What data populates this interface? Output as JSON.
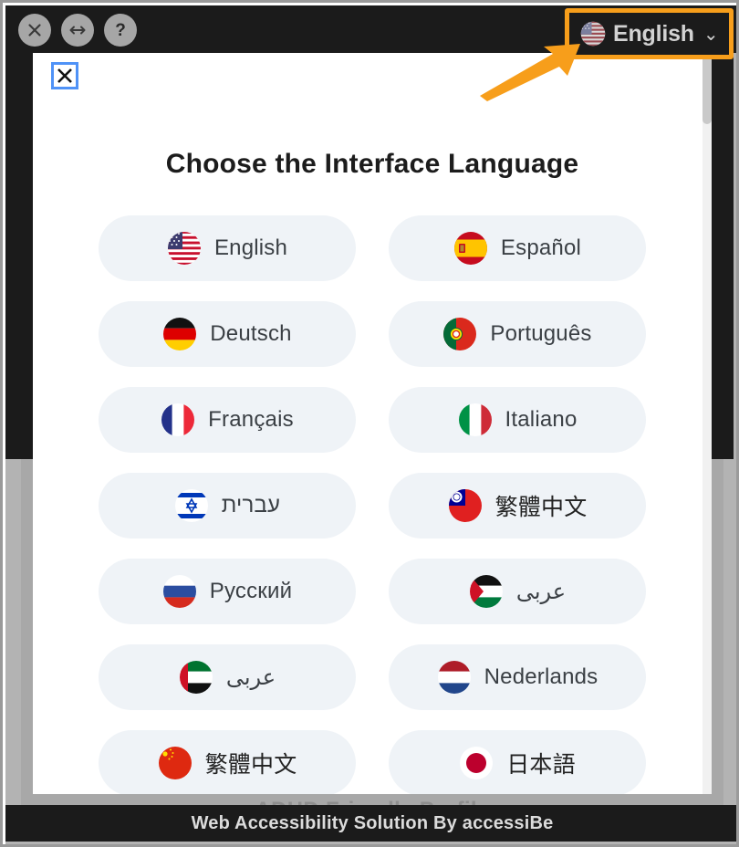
{
  "window": {
    "toolbar": {
      "close_label": "✕",
      "resize_label": "↔",
      "help_label": "?"
    },
    "language_selector": {
      "label": "English",
      "chevron": "⌄",
      "flag": "flag-us-icon",
      "highlight_color": "#F79E1B"
    },
    "footer_text": "Web Accessibility Solution By accessiBe"
  },
  "dialog": {
    "close_label": "✕",
    "title": "Choose the Interface Language",
    "languages": [
      {
        "label": "English",
        "flag": "flag-us-icon",
        "rtl": false,
        "cjk": false
      },
      {
        "label": "Español",
        "flag": "flag-es-icon",
        "rtl": false,
        "cjk": false
      },
      {
        "label": "Deutsch",
        "flag": "flag-de-icon",
        "rtl": false,
        "cjk": false
      },
      {
        "label": "Português",
        "flag": "flag-pt-icon",
        "rtl": false,
        "cjk": false
      },
      {
        "label": "Français",
        "flag": "flag-fr-icon",
        "rtl": false,
        "cjk": false
      },
      {
        "label": "Italiano",
        "flag": "flag-it-icon",
        "rtl": false,
        "cjk": false
      },
      {
        "label": "עברית",
        "flag": "flag-il-icon",
        "rtl": true,
        "cjk": false
      },
      {
        "label": "繁體中文",
        "flag": "flag-tw-icon",
        "rtl": false,
        "cjk": true
      },
      {
        "label": "Русский",
        "flag": "flag-ru-icon",
        "rtl": false,
        "cjk": false
      },
      {
        "label": "عربى",
        "flag": "flag-ps-icon",
        "rtl": true,
        "cjk": false
      },
      {
        "label": "عربى",
        "flag": "flag-ae-icon",
        "rtl": true,
        "cjk": false
      },
      {
        "label": "Nederlands",
        "flag": "flag-nl-icon",
        "rtl": false,
        "cjk": false
      },
      {
        "label": "繁體中文",
        "flag": "flag-cn-icon",
        "rtl": false,
        "cjk": true
      },
      {
        "label": "日本語",
        "flag": "flag-jp-icon",
        "rtl": false,
        "cjk": true
      }
    ]
  },
  "background": {
    "obscured_profile_text": "ADHD Friendly Profile"
  },
  "colors": {
    "topbar": "#1b1b1b",
    "pill": "#eff3f7",
    "accent_orange": "#F79E1B",
    "focus_blue": "#4f92f7",
    "text": "#3a3f44"
  }
}
